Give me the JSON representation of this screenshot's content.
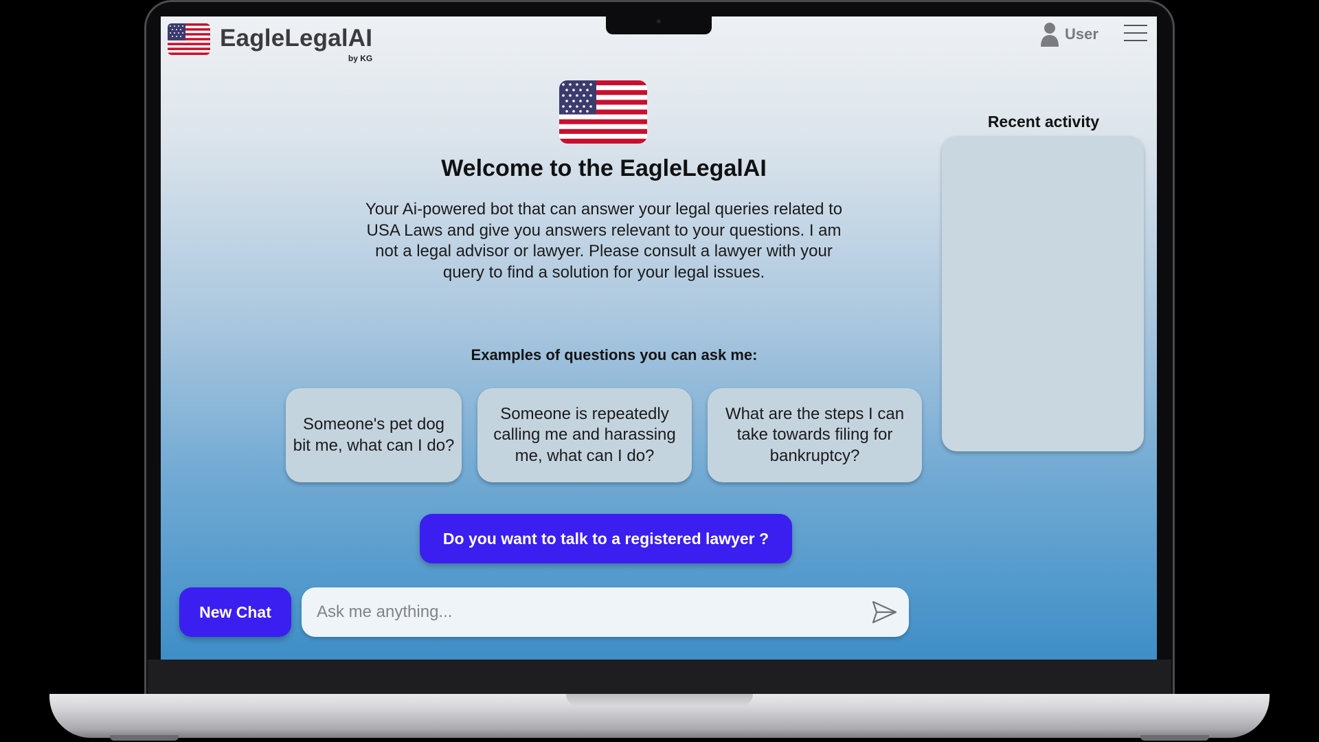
{
  "app": {
    "name": "EagleLegalAI",
    "byline": "by KG"
  },
  "header": {
    "user_label": "User",
    "icons": [
      "us-flag-icon",
      "user-icon",
      "hamburger-menu-icon"
    ]
  },
  "main": {
    "title": "Welcome to the EagleLegalAI",
    "description": "Your Ai-powered bot that can answer your legal queries related to USA Laws and give you answers relevant to your questions. I am not a legal advisor or lawyer. Please consult a lawyer with your query to find a solution for your legal issues.",
    "examples_title": "Examples of questions you can ask me:",
    "examples": [
      "Someone's pet dog bit me, what can I do?",
      "Someone is repeatedly calling me and harassing me, what can I do?",
      "What are the steps I can take towards filing for bankruptcy?"
    ],
    "lawyer_button": "Do you want to talk to a registered lawyer ?"
  },
  "chat": {
    "new_chat_label": "New Chat",
    "placeholder": "Ask me anything..."
  },
  "sidebar": {
    "recent_title": "Recent activity"
  },
  "colors": {
    "accent": "#3B1EF0",
    "card": "#C4D4DF",
    "gradient_top": "#EEF1F4",
    "gradient_bottom": "#3E8EC7"
  }
}
